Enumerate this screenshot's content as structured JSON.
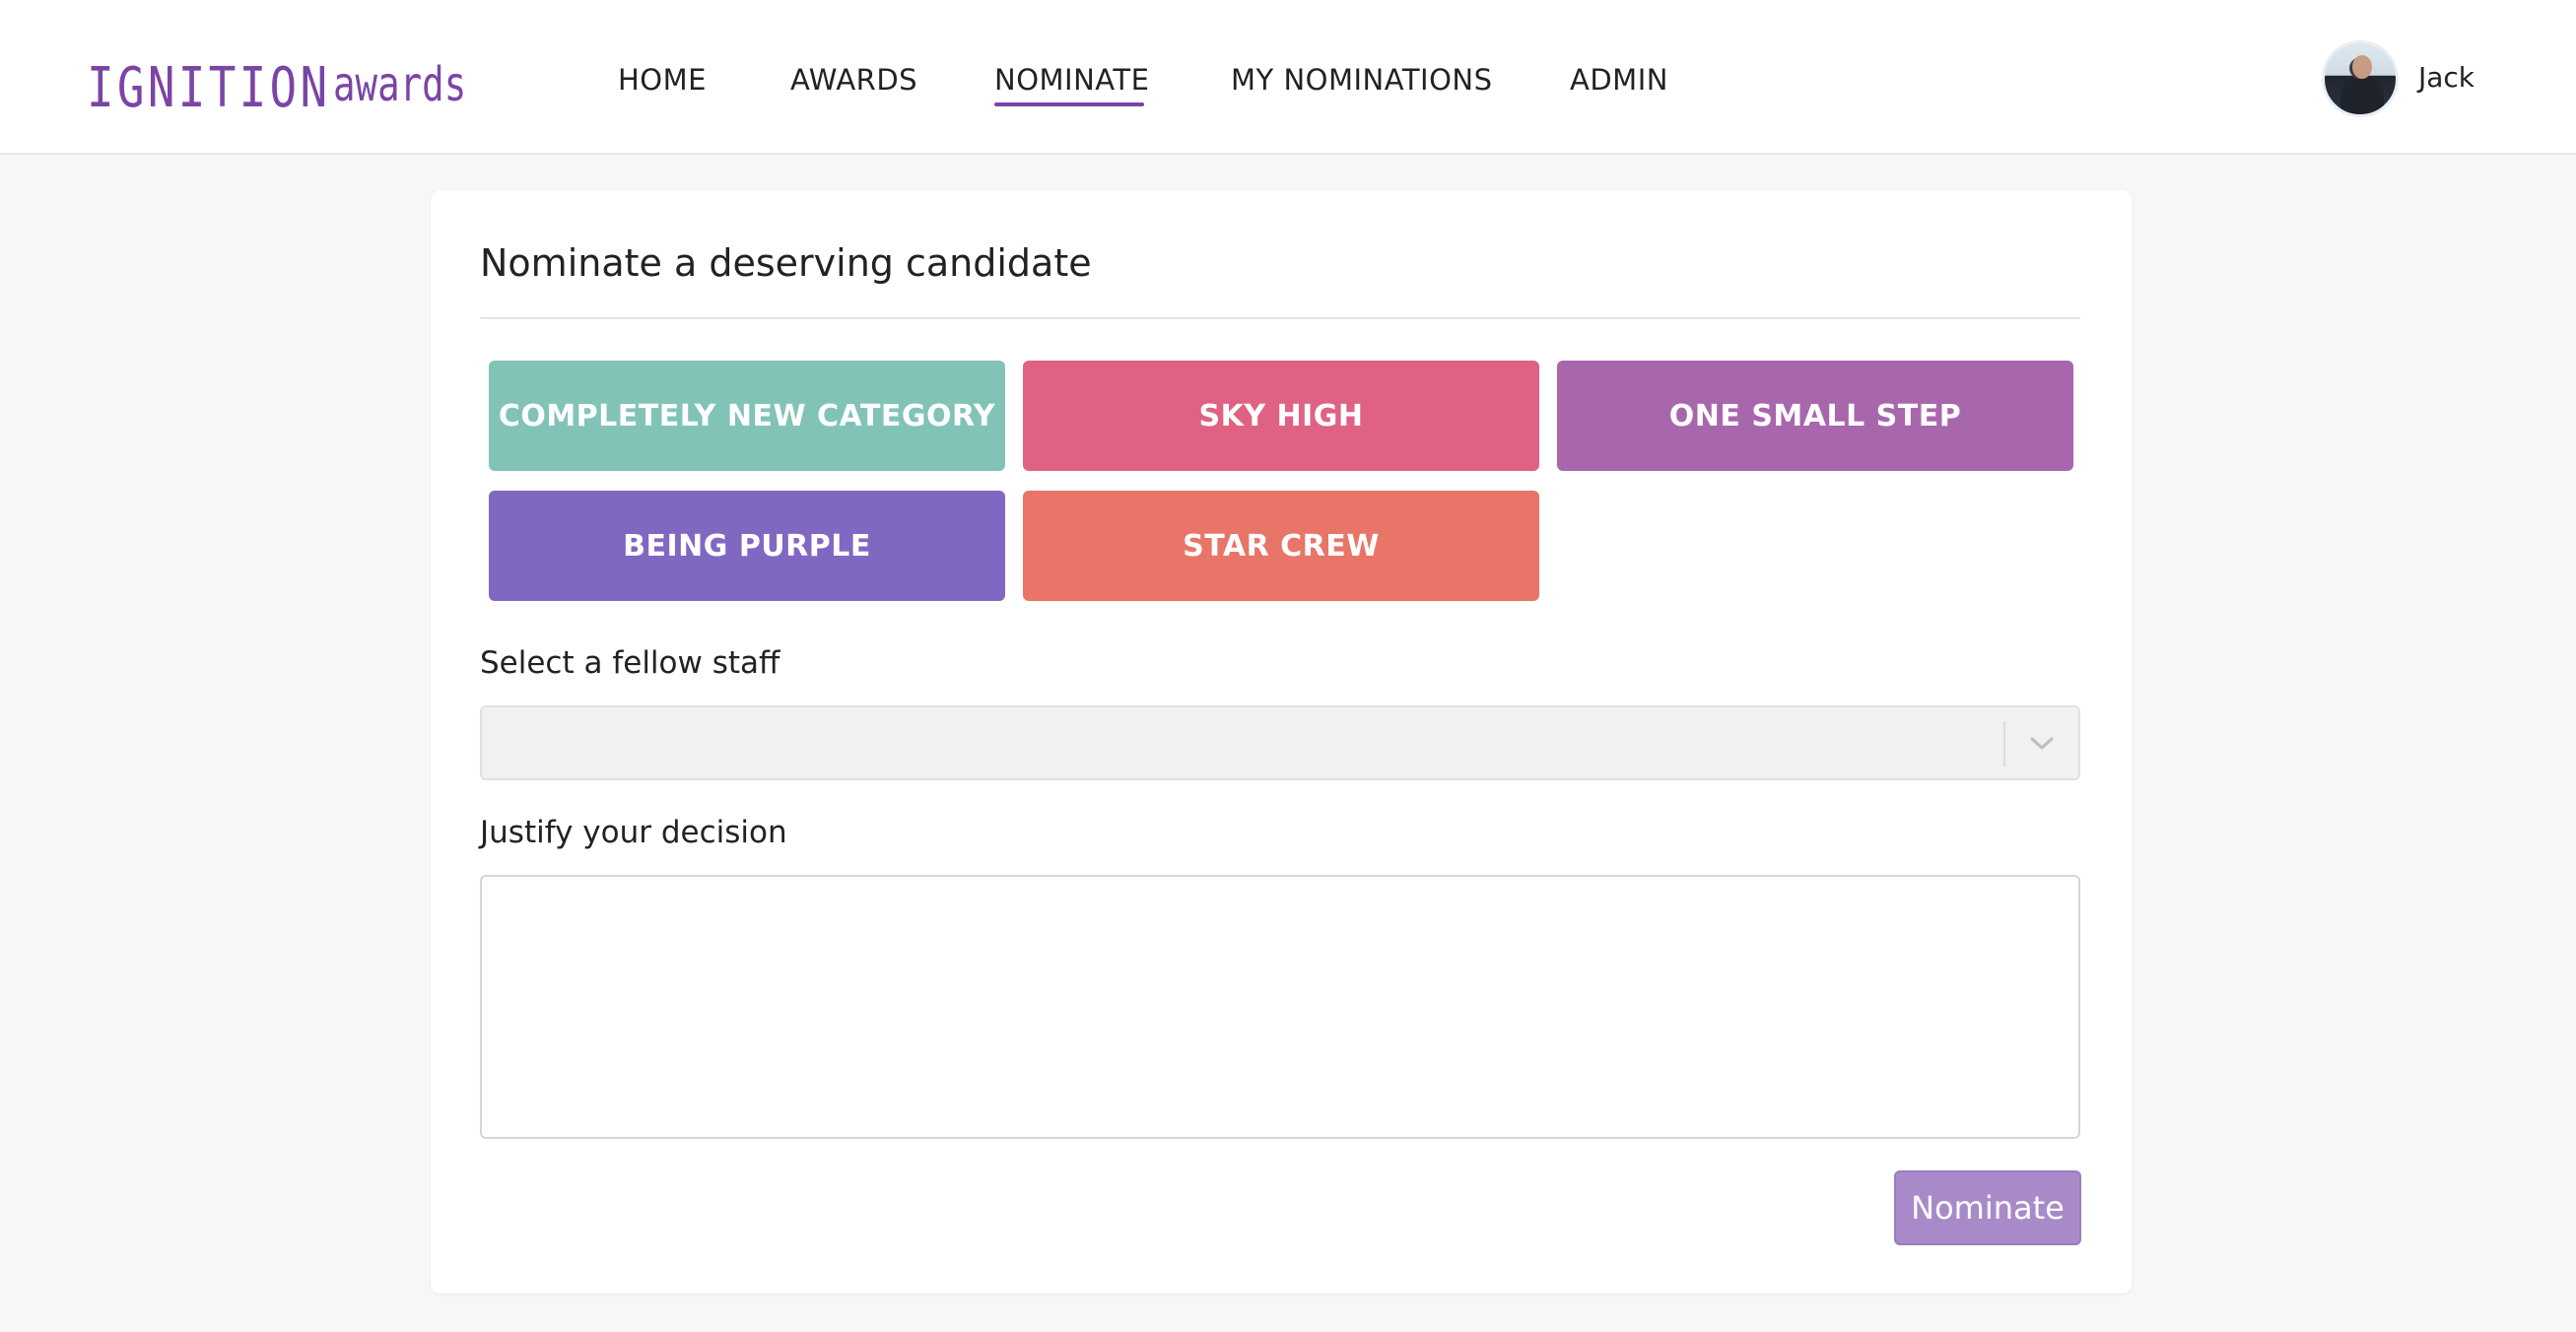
{
  "brand": {
    "main": "IGNITION",
    "sub": "awards",
    "color": "#7a45a6"
  },
  "nav": {
    "items": [
      {
        "label": "HOME"
      },
      {
        "label": "AWARDS"
      },
      {
        "label": "NOMINATE"
      },
      {
        "label": "MY NOMINATIONS"
      },
      {
        "label": "ADMIN"
      }
    ],
    "active": "NOMINATE"
  },
  "user": {
    "name": "Jack",
    "avatar_icon": "user-avatar-photo"
  },
  "form": {
    "title": "Nominate a deserving candidate",
    "categories": [
      {
        "label": "COMPLETELY NEW CATEGORY",
        "color": "#82c3b8"
      },
      {
        "label": "SKY HIGH",
        "color": "#e06282"
      },
      {
        "label": "ONE SMALL STEP",
        "color": "#a866ad"
      },
      {
        "label": "BEING PURPLE",
        "color": "#8068c2"
      },
      {
        "label": "STAR CREW",
        "color": "#e87568"
      }
    ],
    "staff_label": "Select a fellow staff",
    "staff_value": "",
    "staff_icon": "chevron-down-icon",
    "justify_label": "Justify your decision",
    "justify_value": "",
    "submit_label": "Nominate",
    "submit_color": "#a98ac9"
  }
}
